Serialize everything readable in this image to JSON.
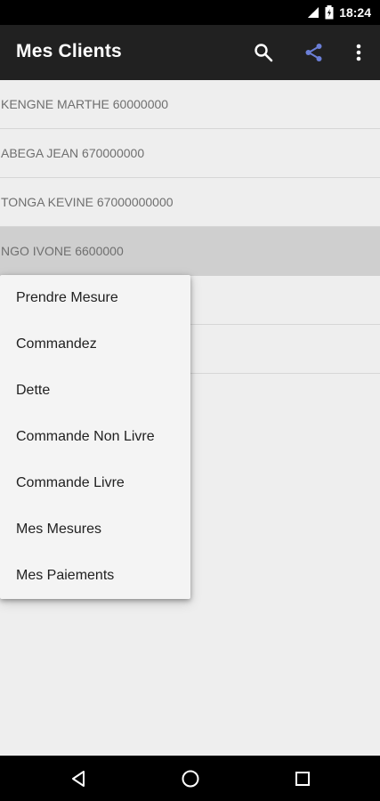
{
  "status_bar": {
    "time": "18:24"
  },
  "app_bar": {
    "title": "Mes Clients",
    "actions": [
      "search-icon",
      "share-icon",
      "more-vert-icon"
    ],
    "share_color": "#6b7fd7"
  },
  "clients": [
    {
      "label": "KENGNE MARTHE 60000000",
      "selected": false
    },
    {
      "label": "ABEGA JEAN 670000000",
      "selected": false
    },
    {
      "label": "TONGA KEVINE 67000000000",
      "selected": false
    },
    {
      "label": "NGO IVONE 6600000",
      "selected": true
    },
    {
      "label": "",
      "selected": false
    },
    {
      "label": "",
      "selected": false
    }
  ],
  "context_menu": {
    "items": [
      "Prendre Mesure",
      "Commandez",
      "Dette",
      "Commande Non Livre",
      "Commande Livre",
      "Mes Mesures",
      "Mes Paiements"
    ]
  },
  "nav_bar": {
    "buttons": [
      "back-icon",
      "home-icon",
      "recents-icon"
    ]
  }
}
